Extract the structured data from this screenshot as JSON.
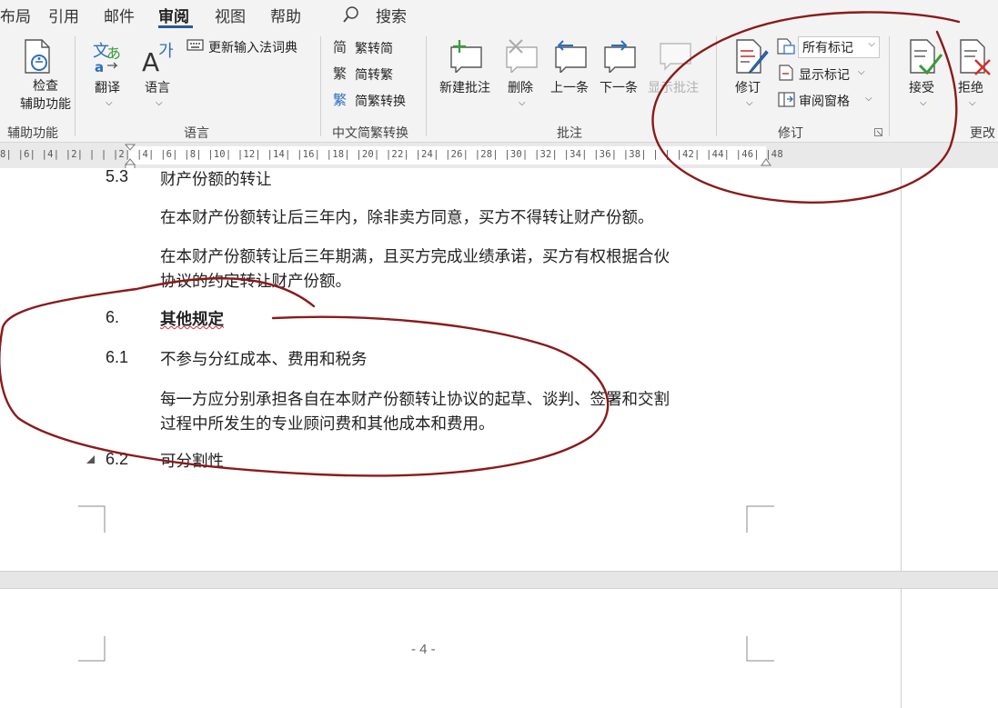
{
  "tabs": {
    "layout": "布局",
    "references": "引用",
    "mailings": "邮件",
    "review": "审阅",
    "view": "视图",
    "help": "帮助",
    "search": "搜索"
  },
  "ribbon": {
    "accessibility": {
      "check_line1": "检查",
      "check_line2": "辅助功能",
      "group": "辅助功能"
    },
    "language": {
      "translate": "翻译",
      "language": "语言",
      "update_ime": "更新输入法词典",
      "group": "语言"
    },
    "chinese": {
      "trad_to_simp": "繁转简",
      "simp_to_trad": "简转繁",
      "convert": "简繁转换",
      "group": "中文简繁转换"
    },
    "comments": {
      "new": "新建批注",
      "delete": "删除",
      "previous": "上一条",
      "next": "下一条",
      "show": "显示批注",
      "group": "批注"
    },
    "tracking": {
      "track_changes": "修订",
      "markup_select": "所有标记",
      "show_markup": "显示标记",
      "reviewing_pane": "审阅窗格",
      "group": "修订"
    },
    "changes": {
      "accept": "接受",
      "reject": "拒绝",
      "group": "更改"
    }
  },
  "ruler": {
    "numbers": "8| |6| |4| |2| | | |2| |4| |6| |8| |10| |12| |14| |16| |18| |20| |22| |24| |26| |28| |30| |32| |34| |36| |38| | | |42| |44| |46| |48"
  },
  "document": {
    "sec53_num": "5.3",
    "sec53_title": "财产份额的转让",
    "para1": "在本财产份额转让后三年内，除非卖方同意，买方不得转让财产份额。",
    "para2_line1": "在本财产份额转让后三年期满，且买方完成业绩承诺，买方有权根据合伙",
    "para2_line2": "协议的约定转让财产份额。",
    "sec6_num": "6.",
    "sec6_title": "其他规定",
    "sec61_num": "6.1",
    "sec61_title": "不参与分红成本、费用和税务",
    "para3_line1": "每一方应分别承担各自在本财产份额转让协议的起草、谈判、签署和交割",
    "para3_line2": "过程中所发生的专业顾问费和其他成本和费用。",
    "sec62_num": "6.2",
    "sec62_title": "可分割性",
    "page_number": "- 4 -"
  },
  "colors": {
    "accent": "#2b579a",
    "annotation": "#8b1a1a",
    "comment_green": "#3a9a3a",
    "reject_red": "#d03030"
  }
}
